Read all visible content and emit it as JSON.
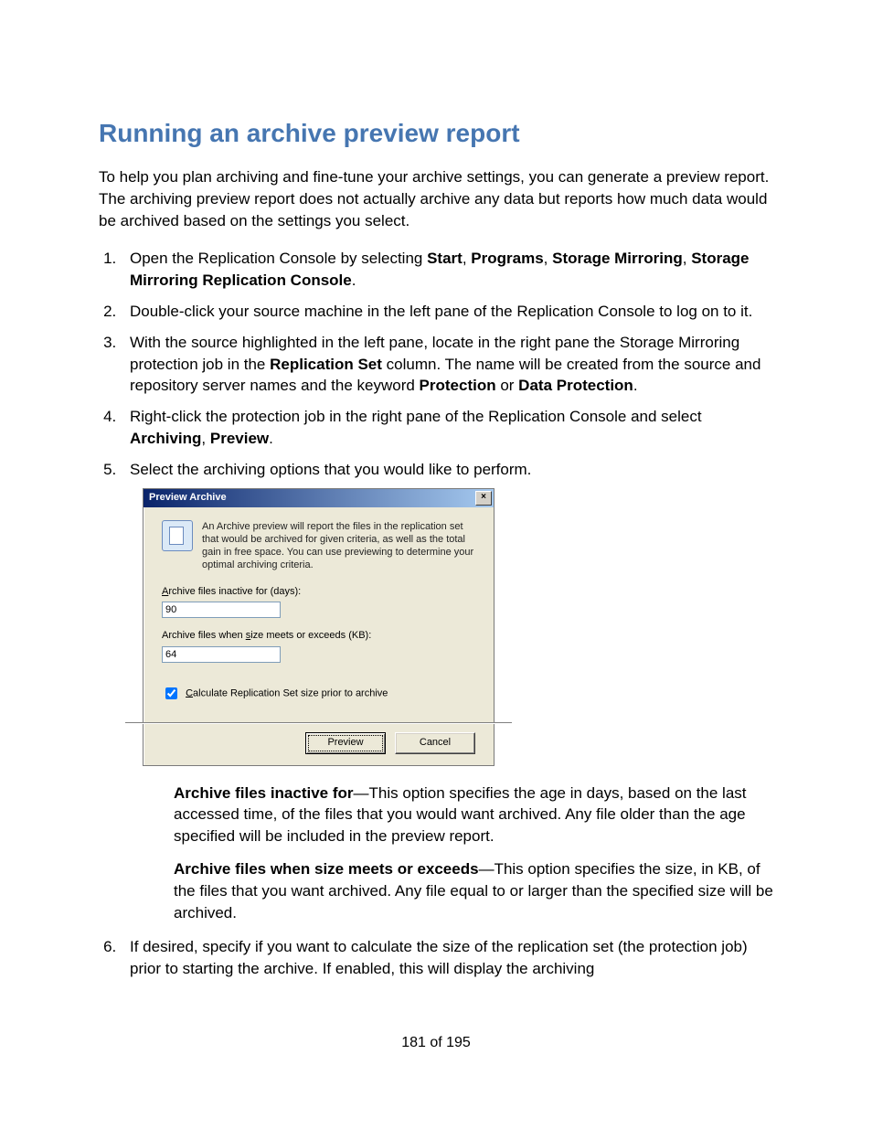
{
  "title": "Running an archive preview report",
  "intro": "To help you plan archiving and fine-tune your archive settings, you can generate a preview report. The archiving preview report does not actually archive any data but reports how much data would be archived based on the settings you select.",
  "steps": {
    "s1a": "Open the Replication Console by selecting ",
    "s1_start": "Start",
    "s1_sep": ", ",
    "s1_programs": "Programs",
    "s1_sm": "Storage Mirroring",
    "s1_smrc": "Storage Mirroring Replication Console",
    "s1_end": ".",
    "s2": "Double-click your source machine in the left pane of the Replication Console to log on to it.",
    "s3a": "With the source highlighted in the left pane, locate in the right pane the Storage Mirroring protection job in the ",
    "s3_col": "Replication Set",
    "s3b": " column. The name will be created from the source and repository server names and the keyword ",
    "s3_p": "Protection",
    "s3_or": " or ",
    "s3_dp": "Data Protection",
    "s3_end": ".",
    "s4a": "Right-click the protection job in the right pane of the Replication Console and select ",
    "s4_arch": "Archiving",
    "s4_sep": ", ",
    "s4_prev": "Preview",
    "s4_end": ".",
    "s5": "Select the archiving options that you would like to perform.",
    "s6": "If desired, specify if you want to calculate the size of the replication set (the protection job) prior to starting the archive. If enabled, this will display the archiving"
  },
  "dialog": {
    "title": "Preview Archive",
    "close": "×",
    "desc": "An Archive preview will report the files in the replication set that would be archived for given criteria, as well as the total gain in free space. You can use previewing to determine your optimal archiving criteria.",
    "days_label_pre": "A",
    "days_label": "rchive files inactive for (days):",
    "days_value": "90",
    "size_label_a": "Archive files when ",
    "size_label_u": "s",
    "size_label_b": "ize meets or exceeds (KB):",
    "size_value": "64",
    "check_pre": "C",
    "check_label": "alculate Replication Set size prior to archive",
    "preview_btn": "Preview",
    "cancel_btn": "Cancel"
  },
  "opts": {
    "o1_t": "Archive files inactive for",
    "o1_b": "—This option specifies the age in days, based on the last accessed time, of the files that you would want archived. Any file older than the age specified will be included in the preview report.",
    "o2_t": "Archive files when size meets or exceeds",
    "o2_b": "—This option specifies the size, in KB, of the files that you want archived. Any file equal to or larger than the specified size will be archived."
  },
  "footer": "181 of 195"
}
